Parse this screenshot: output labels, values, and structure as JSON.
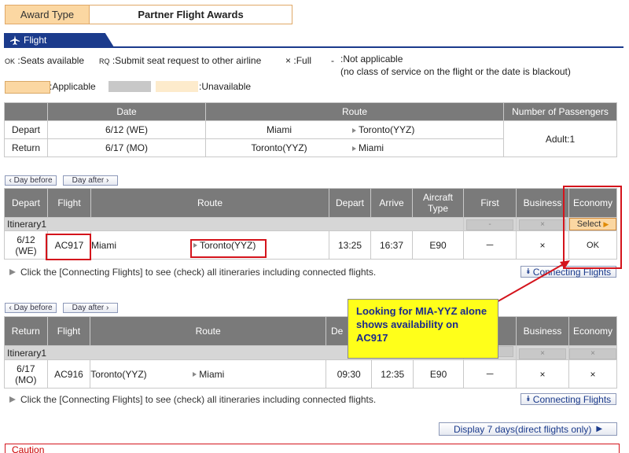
{
  "award": {
    "label": "Award Type",
    "value": "Partner Flight Awards"
  },
  "flight_tab": {
    "label": "Flight",
    "icon": "airplane-icon"
  },
  "legend": {
    "ok_code": "OK",
    "ok_text": ":Seats available",
    "rq_code": "RQ",
    "rq_text": ":Submit seat request to other airline",
    "full_code": "×",
    "full_text": ":Full",
    "na_code": "-",
    "na_text": ":Not applicable",
    "na_detail": "(no class of service on the flight or the date is blackout)",
    "applicable": ":Applicable",
    "unavailable": ":Unavailable",
    "applicable_color": "#fbd7a2",
    "grey_color": "#c8c8c8",
    "unavailable_color": "#fdebcc"
  },
  "summary": {
    "headers": [
      "Date",
      "Route",
      "Number of Passengers"
    ],
    "rows": [
      {
        "label": "Depart",
        "date": "6/12 (WE)",
        "from": "Miami",
        "to": "Toronto(YYZ)"
      },
      {
        "label": "Return",
        "date": "6/17 (MO)",
        "from": "Toronto(YYZ)",
        "to": "Miami"
      }
    ],
    "passengers": "Adult:1"
  },
  "nav": {
    "day_before": "Day before",
    "day_after": "Day after"
  },
  "depart_table": {
    "headers": [
      "Depart",
      "Flight",
      "Route",
      "Depart",
      "Arrive",
      "Aircraft Type",
      "First",
      "Business",
      "Economy"
    ],
    "itinerary": "Itinerary1",
    "first_status": "-",
    "business_status": "×",
    "economy_button": "Select",
    "row": {
      "date": "6/12",
      "day": "(WE)",
      "flight": "AC917",
      "from": "Miami",
      "to": "Toronto(YYZ)",
      "depart": "13:25",
      "arrive": "16:37",
      "aircraft": "E90",
      "first": "－",
      "business": "×",
      "economy": "OK"
    }
  },
  "return_table": {
    "headers": [
      "Return",
      "Flight",
      "Route",
      "De",
      "Business",
      "Economy"
    ],
    "itinerary": "Itinerary1",
    "business_status": "×",
    "economy_status": "×",
    "row": {
      "date": "6/17",
      "day": "(MO)",
      "flight": "AC916",
      "from": "Toronto(YYZ)",
      "to": "Miami",
      "depart": "09:30",
      "arrive": "12:35",
      "aircraft": "E90",
      "first": "－",
      "business": "×",
      "economy": "×"
    }
  },
  "connecting_note": "Click the [Connecting Flights] to see (check) all itineraries including connected flights.",
  "connecting_button": "Connecting Flights",
  "callout": "Looking for MIA-YYZ alone shows availability on AC917",
  "display7": "Display 7 days(direct flights only)",
  "caution": "Caution"
}
